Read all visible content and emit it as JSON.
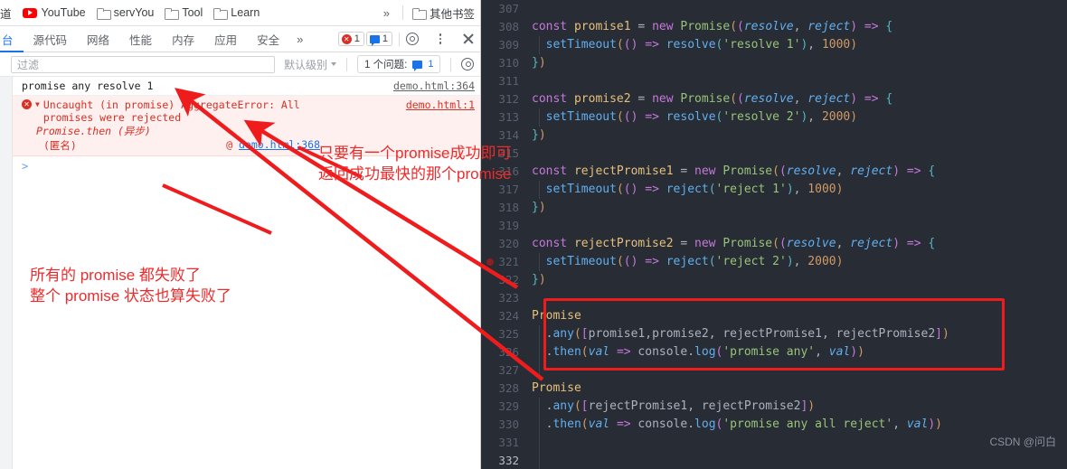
{
  "bookmarks": {
    "items": [
      {
        "label": "道",
        "icon": "text-bookmark",
        "truncated": true
      },
      {
        "label": "YouTube",
        "icon": "youtube-icon"
      },
      {
        "label": "servYou",
        "icon": "folder-icon"
      },
      {
        "label": "Tool",
        "icon": "folder-icon"
      },
      {
        "label": "Learn",
        "icon": "folder-icon"
      }
    ],
    "overflow_label": "»",
    "other_bookmarks": "其他书签"
  },
  "devtools": {
    "tabs": [
      {
        "label": "台",
        "active": true
      },
      {
        "label": "源代码",
        "active": false
      },
      {
        "label": "网络",
        "active": false
      },
      {
        "label": "性能",
        "active": false
      },
      {
        "label": "内存",
        "active": false
      },
      {
        "label": "应用",
        "active": false
      },
      {
        "label": "安全",
        "active": false
      }
    ],
    "more_tabs": "»",
    "error_count": "1",
    "message_count": "1",
    "icons": {
      "settings": "gear-icon",
      "menu": "kebab-menu-icon",
      "close": "close-icon",
      "error_badge": "error-icon",
      "message_badge": "message-icon"
    }
  },
  "filter_bar": {
    "placeholder": "过滤",
    "value": "",
    "level_label": "默认级别",
    "issues_label": "1 个问题:",
    "issues_count": "1",
    "settings_icon": "gear-icon"
  },
  "console": {
    "log_row": {
      "message": "promise any resolve 1",
      "source": "demo.html:364"
    },
    "error_row": {
      "message": "Uncaught (in promise) AggregateError: All promises were rejected",
      "source": "demo.html:1",
      "stack_async": "Promise.then (异步)",
      "stack_anon": "(匿名)",
      "stack_at": "@",
      "stack_link": "demo.html:368"
    },
    "prompt": ">"
  },
  "annotations": {
    "left": [
      "所有的 promise 都失败了",
      "整个 promise 状态也算失败了"
    ],
    "right": [
      "只要有一个promise成功即可",
      "返回成功最快的那个promise"
    ],
    "color": "#ee2b2b"
  },
  "editor": {
    "watermark": "CSDN @问白",
    "breakpoint_line": "321",
    "highlight_box_color": "#ee1c1c",
    "lines": [
      {
        "no": "307",
        "tokens": []
      },
      {
        "no": "308",
        "tokens": [
          {
            "t": "const ",
            "c": "k"
          },
          {
            "t": "promise1",
            "c": "var"
          },
          {
            "t": " = ",
            "c": "pn"
          },
          {
            "t": "new ",
            "c": "k"
          },
          {
            "t": "Promise",
            "c": "cls"
          },
          {
            "t": "(",
            "c": "br1"
          },
          {
            "t": "(",
            "c": "br2"
          },
          {
            "t": "resolve",
            "c": "par"
          },
          {
            "t": ", ",
            "c": "pn"
          },
          {
            "t": "reject",
            "c": "par"
          },
          {
            "t": ")",
            "c": "br2"
          },
          {
            "t": " ",
            "c": "pn"
          },
          {
            "t": "=>",
            "c": "k"
          },
          {
            "t": " ",
            "c": "pn"
          },
          {
            "t": "{",
            "c": "br3"
          }
        ]
      },
      {
        "no": "309",
        "guide": true,
        "tokens": [
          {
            "t": "  ",
            "c": "pn"
          },
          {
            "t": "setTimeout",
            "c": "fn"
          },
          {
            "t": "(",
            "c": "br1"
          },
          {
            "t": "()",
            "c": "br2"
          },
          {
            "t": " ",
            "c": "pn"
          },
          {
            "t": "=>",
            "c": "k"
          },
          {
            "t": " ",
            "c": "pn"
          },
          {
            "t": "resolve",
            "c": "fn"
          },
          {
            "t": "(",
            "c": "br3"
          },
          {
            "t": "'resolve 1'",
            "c": "str"
          },
          {
            "t": ")",
            "c": "br3"
          },
          {
            "t": ", ",
            "c": "pn"
          },
          {
            "t": "1000",
            "c": "num"
          },
          {
            "t": ")",
            "c": "br1"
          }
        ]
      },
      {
        "no": "310",
        "tokens": [
          {
            "t": "}",
            "c": "br3"
          },
          {
            "t": ")",
            "c": "br1"
          }
        ]
      },
      {
        "no": "311",
        "tokens": []
      },
      {
        "no": "312",
        "tokens": [
          {
            "t": "const ",
            "c": "k"
          },
          {
            "t": "promise2",
            "c": "var"
          },
          {
            "t": " = ",
            "c": "pn"
          },
          {
            "t": "new ",
            "c": "k"
          },
          {
            "t": "Promise",
            "c": "cls"
          },
          {
            "t": "(",
            "c": "br1"
          },
          {
            "t": "(",
            "c": "br2"
          },
          {
            "t": "resolve",
            "c": "par"
          },
          {
            "t": ", ",
            "c": "pn"
          },
          {
            "t": "reject",
            "c": "par"
          },
          {
            "t": ")",
            "c": "br2"
          },
          {
            "t": " ",
            "c": "pn"
          },
          {
            "t": "=>",
            "c": "k"
          },
          {
            "t": " ",
            "c": "pn"
          },
          {
            "t": "{",
            "c": "br3"
          }
        ]
      },
      {
        "no": "313",
        "guide": true,
        "tokens": [
          {
            "t": "  ",
            "c": "pn"
          },
          {
            "t": "setTimeout",
            "c": "fn"
          },
          {
            "t": "(",
            "c": "br1"
          },
          {
            "t": "()",
            "c": "br2"
          },
          {
            "t": " ",
            "c": "pn"
          },
          {
            "t": "=>",
            "c": "k"
          },
          {
            "t": " ",
            "c": "pn"
          },
          {
            "t": "resolve",
            "c": "fn"
          },
          {
            "t": "(",
            "c": "br3"
          },
          {
            "t": "'resolve 2'",
            "c": "str"
          },
          {
            "t": ")",
            "c": "br3"
          },
          {
            "t": ", ",
            "c": "pn"
          },
          {
            "t": "2000",
            "c": "num"
          },
          {
            "t": ")",
            "c": "br1"
          }
        ]
      },
      {
        "no": "314",
        "tokens": [
          {
            "t": "}",
            "c": "br3"
          },
          {
            "t": ")",
            "c": "br1"
          }
        ]
      },
      {
        "no": "315",
        "tokens": []
      },
      {
        "no": "316",
        "tokens": [
          {
            "t": "const ",
            "c": "k"
          },
          {
            "t": "rejectPromise1",
            "c": "var"
          },
          {
            "t": " = ",
            "c": "pn"
          },
          {
            "t": "new ",
            "c": "k"
          },
          {
            "t": "Promise",
            "c": "cls"
          },
          {
            "t": "(",
            "c": "br1"
          },
          {
            "t": "(",
            "c": "br2"
          },
          {
            "t": "resolve",
            "c": "par"
          },
          {
            "t": ", ",
            "c": "pn"
          },
          {
            "t": "reject",
            "c": "par"
          },
          {
            "t": ")",
            "c": "br2"
          },
          {
            "t": " ",
            "c": "pn"
          },
          {
            "t": "=>",
            "c": "k"
          },
          {
            "t": " ",
            "c": "pn"
          },
          {
            "t": "{",
            "c": "br3"
          }
        ]
      },
      {
        "no": "317",
        "guide": true,
        "tokens": [
          {
            "t": "  ",
            "c": "pn"
          },
          {
            "t": "setTimeout",
            "c": "fn"
          },
          {
            "t": "(",
            "c": "br1"
          },
          {
            "t": "()",
            "c": "br2"
          },
          {
            "t": " ",
            "c": "pn"
          },
          {
            "t": "=>",
            "c": "k"
          },
          {
            "t": " ",
            "c": "pn"
          },
          {
            "t": "reject",
            "c": "fn"
          },
          {
            "t": "(",
            "c": "br3"
          },
          {
            "t": "'reject 1'",
            "c": "str"
          },
          {
            "t": ")",
            "c": "br3"
          },
          {
            "t": ", ",
            "c": "pn"
          },
          {
            "t": "1000",
            "c": "num"
          },
          {
            "t": ")",
            "c": "br1"
          }
        ]
      },
      {
        "no": "318",
        "tokens": [
          {
            "t": "}",
            "c": "br3"
          },
          {
            "t": ")",
            "c": "br1"
          }
        ]
      },
      {
        "no": "319",
        "tokens": []
      },
      {
        "no": "320",
        "tokens": [
          {
            "t": "const ",
            "c": "k"
          },
          {
            "t": "rejectPromise2",
            "c": "var"
          },
          {
            "t": " = ",
            "c": "pn"
          },
          {
            "t": "new ",
            "c": "k"
          },
          {
            "t": "Promise",
            "c": "cls"
          },
          {
            "t": "(",
            "c": "br1"
          },
          {
            "t": "(",
            "c": "br2"
          },
          {
            "t": "resolve",
            "c": "par"
          },
          {
            "t": ", ",
            "c": "pn"
          },
          {
            "t": "reject",
            "c": "par"
          },
          {
            "t": ")",
            "c": "br2"
          },
          {
            "t": " ",
            "c": "pn"
          },
          {
            "t": "=>",
            "c": "k"
          },
          {
            "t": " ",
            "c": "pn"
          },
          {
            "t": "{",
            "c": "br3"
          }
        ]
      },
      {
        "no": "321",
        "guide": true,
        "breakpoint": true,
        "tokens": [
          {
            "t": "  ",
            "c": "pn"
          },
          {
            "t": "setTimeout",
            "c": "fn"
          },
          {
            "t": "(",
            "c": "br1"
          },
          {
            "t": "()",
            "c": "br2"
          },
          {
            "t": " ",
            "c": "pn"
          },
          {
            "t": "=>",
            "c": "k"
          },
          {
            "t": " ",
            "c": "pn"
          },
          {
            "t": "reject",
            "c": "fn"
          },
          {
            "t": "(",
            "c": "br3"
          },
          {
            "t": "'reject 2'",
            "c": "str"
          },
          {
            "t": ")",
            "c": "br3"
          },
          {
            "t": ", ",
            "c": "pn"
          },
          {
            "t": "2000",
            "c": "num"
          },
          {
            "t": ")",
            "c": "br1"
          }
        ]
      },
      {
        "no": "322",
        "tokens": [
          {
            "t": "}",
            "c": "br3"
          },
          {
            "t": ")",
            "c": "br1"
          }
        ]
      },
      {
        "no": "323",
        "tokens": []
      },
      {
        "no": "324",
        "tokens": [
          {
            "t": "Promise",
            "c": "var"
          }
        ]
      },
      {
        "no": "325",
        "guide": true,
        "tokens": [
          {
            "t": "  .",
            "c": "pn"
          },
          {
            "t": "any",
            "c": "fn"
          },
          {
            "t": "(",
            "c": "br1"
          },
          {
            "t": "[",
            "c": "br2"
          },
          {
            "t": "promise1",
            "c": "pn"
          },
          {
            "t": ",",
            "c": "pn"
          },
          {
            "t": "promise2",
            "c": "pn"
          },
          {
            "t": ", ",
            "c": "pn"
          },
          {
            "t": "rejectPromise1",
            "c": "pn"
          },
          {
            "t": ", ",
            "c": "pn"
          },
          {
            "t": "rejectPromise2",
            "c": "pn"
          },
          {
            "t": "]",
            "c": "br2"
          },
          {
            "t": ")",
            "c": "br1"
          }
        ]
      },
      {
        "no": "326",
        "guide": true,
        "tokens": [
          {
            "t": "  .",
            "c": "pn"
          },
          {
            "t": "then",
            "c": "fn"
          },
          {
            "t": "(",
            "c": "br1"
          },
          {
            "t": "val",
            "c": "par"
          },
          {
            "t": " ",
            "c": "pn"
          },
          {
            "t": "=>",
            "c": "k"
          },
          {
            "t": " ",
            "c": "pn"
          },
          {
            "t": "console",
            "c": "pn"
          },
          {
            "t": ".",
            "c": "pn"
          },
          {
            "t": "log",
            "c": "fn"
          },
          {
            "t": "(",
            "c": "br2"
          },
          {
            "t": "'promise any'",
            "c": "str"
          },
          {
            "t": ", ",
            "c": "pn"
          },
          {
            "t": "val",
            "c": "par"
          },
          {
            "t": ")",
            "c": "br2"
          },
          {
            "t": ")",
            "c": "br1"
          }
        ]
      },
      {
        "no": "327",
        "guide": true,
        "tokens": []
      },
      {
        "no": "328",
        "tokens": [
          {
            "t": "Promise",
            "c": "var"
          }
        ]
      },
      {
        "no": "329",
        "guide": true,
        "tokens": [
          {
            "t": "  .",
            "c": "pn"
          },
          {
            "t": "any",
            "c": "fn"
          },
          {
            "t": "(",
            "c": "br1"
          },
          {
            "t": "[",
            "c": "br2"
          },
          {
            "t": "rejectPromise1",
            "c": "pn"
          },
          {
            "t": ", ",
            "c": "pn"
          },
          {
            "t": "rejectPromise2",
            "c": "pn"
          },
          {
            "t": "]",
            "c": "br2"
          },
          {
            "t": ")",
            "c": "br1"
          }
        ]
      },
      {
        "no": "330",
        "guide": true,
        "tokens": [
          {
            "t": "  .",
            "c": "pn"
          },
          {
            "t": "then",
            "c": "fn"
          },
          {
            "t": "(",
            "c": "br1"
          },
          {
            "t": "val",
            "c": "par"
          },
          {
            "t": " ",
            "c": "pn"
          },
          {
            "t": "=>",
            "c": "k"
          },
          {
            "t": " ",
            "c": "pn"
          },
          {
            "t": "console",
            "c": "pn"
          },
          {
            "t": ".",
            "c": "pn"
          },
          {
            "t": "log",
            "c": "fn"
          },
          {
            "t": "(",
            "c": "br2"
          },
          {
            "t": "'promise any all reject'",
            "c": "str"
          },
          {
            "t": ", ",
            "c": "pn"
          },
          {
            "t": "val",
            "c": "par"
          },
          {
            "t": ")",
            "c": "br2"
          },
          {
            "t": ")",
            "c": "br1"
          }
        ]
      },
      {
        "no": "331",
        "guide": true,
        "tokens": []
      },
      {
        "no": "332",
        "current": true,
        "guide": true,
        "tokens": []
      }
    ]
  }
}
